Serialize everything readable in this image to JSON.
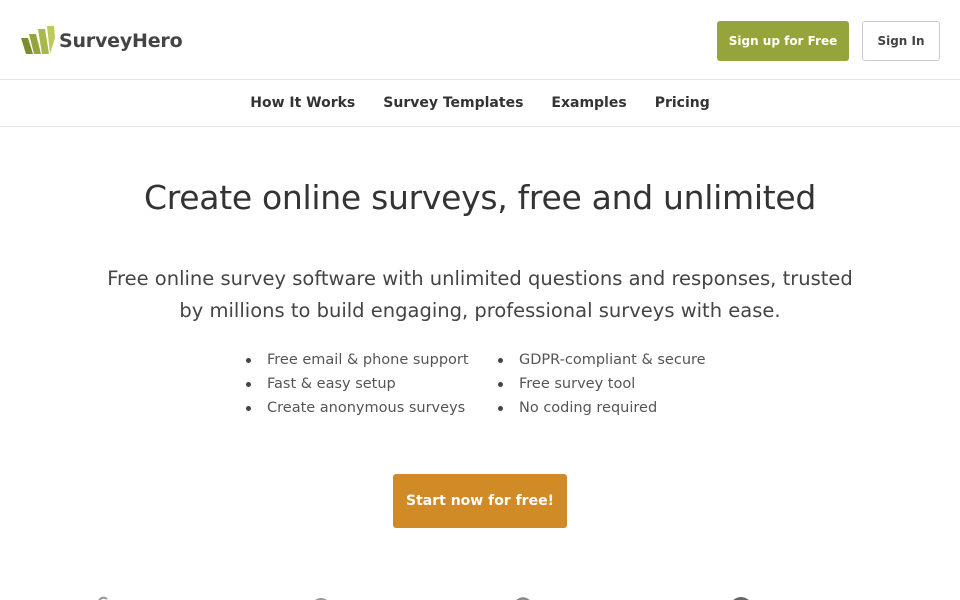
{
  "header": {
    "logo_text": "SurveyHero",
    "signup_label": "Sign up for Free",
    "signin_label": "Sign In"
  },
  "nav": {
    "items": [
      {
        "label": "How It Works"
      },
      {
        "label": "Survey Templates"
      },
      {
        "label": "Examples"
      },
      {
        "label": "Pricing"
      }
    ]
  },
  "hero": {
    "title": "Create online surveys, free and unlimited",
    "subtitle": "Free online survey software with unlimited questions and responses, trusted by millions to build engaging, professional surveys with ease.",
    "features_left": [
      "Free email & phone support",
      "Fast & easy setup",
      "Create anonymous surveys"
    ],
    "features_right": [
      "GDPR-compliant & secure",
      "Free survey tool",
      "No coding required"
    ],
    "cta_label": "Start now for free!"
  },
  "colors": {
    "brand_green": "#96a53b",
    "cta_orange": "#d08a26",
    "text": "#333333"
  },
  "icons": {
    "logo": "surveyhero-logo-icon",
    "bullet": "bullet-dot"
  }
}
